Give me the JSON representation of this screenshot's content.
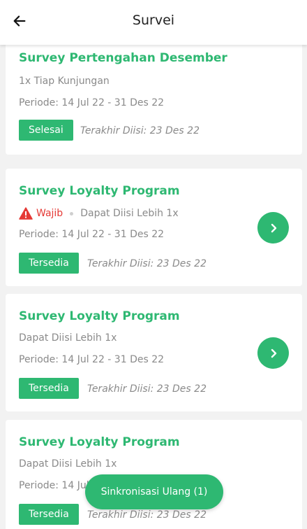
{
  "header": {
    "title": "Survei",
    "back_icon": "arrow-left-icon"
  },
  "colors": {
    "accent": "#2eb872",
    "warning": "#e53935",
    "muted_text": "#8a8a8a",
    "background": "#f2f2f2"
  },
  "surveys": [
    {
      "title": "Survey Pertengahan Desember",
      "frequency": "1x Tiap Kunjungan",
      "period": "Periode: 14 Jul 22 - 31 Des 22",
      "status": "Selesai",
      "last_filled": "Terakhir Diisi: 23 Des 22"
    },
    {
      "title": "Survey Loyalty Program",
      "required_label": "Wajib",
      "frequency": "Dapat Diisi Lebih 1x",
      "period": "Periode: 14 Jul 22 - 31 Des 22",
      "status": "Tersedia",
      "last_filled": "Terakhir Diisi: 23 Des 22"
    },
    {
      "title": "Survey Loyalty Program",
      "frequency": "Dapat Diisi Lebih 1x",
      "period": "Periode: 14 Jul 22 - 31 Des 22",
      "status": "Tersedia",
      "last_filled": "Terakhir Diisi: 23 Des 22"
    },
    {
      "title": "Survey Loyalty Program",
      "frequency": "Dapat Diisi Lebih 1x",
      "period": "Periode: 14 Jul",
      "status": "Tersedia",
      "last_filled": "Terakhir Diisi: 23 Des 22"
    }
  ],
  "sync_button": {
    "label": "Sinkronisasi Ulang (1)"
  }
}
